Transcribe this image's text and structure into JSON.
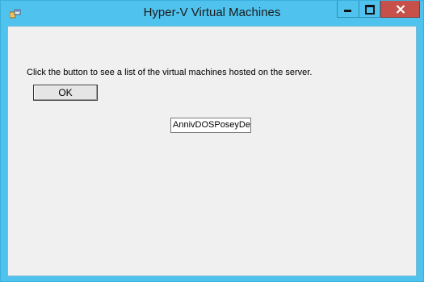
{
  "window": {
    "title": "Hyper-V Virtual Machines",
    "icons": {
      "app": "application-icon",
      "minimize": "minimize-icon",
      "maximize": "maximize-icon",
      "close": "close-icon"
    },
    "colors": {
      "frame": "#4fc3ee",
      "close_button": "#c7504a",
      "client_background": "#f0f0f0"
    }
  },
  "form": {
    "instruction": "Click the button to see a list of the virtual machines hosted on the server.",
    "ok_label": "OK",
    "vm_list_value": "AnnivDOSPoseyDem"
  }
}
